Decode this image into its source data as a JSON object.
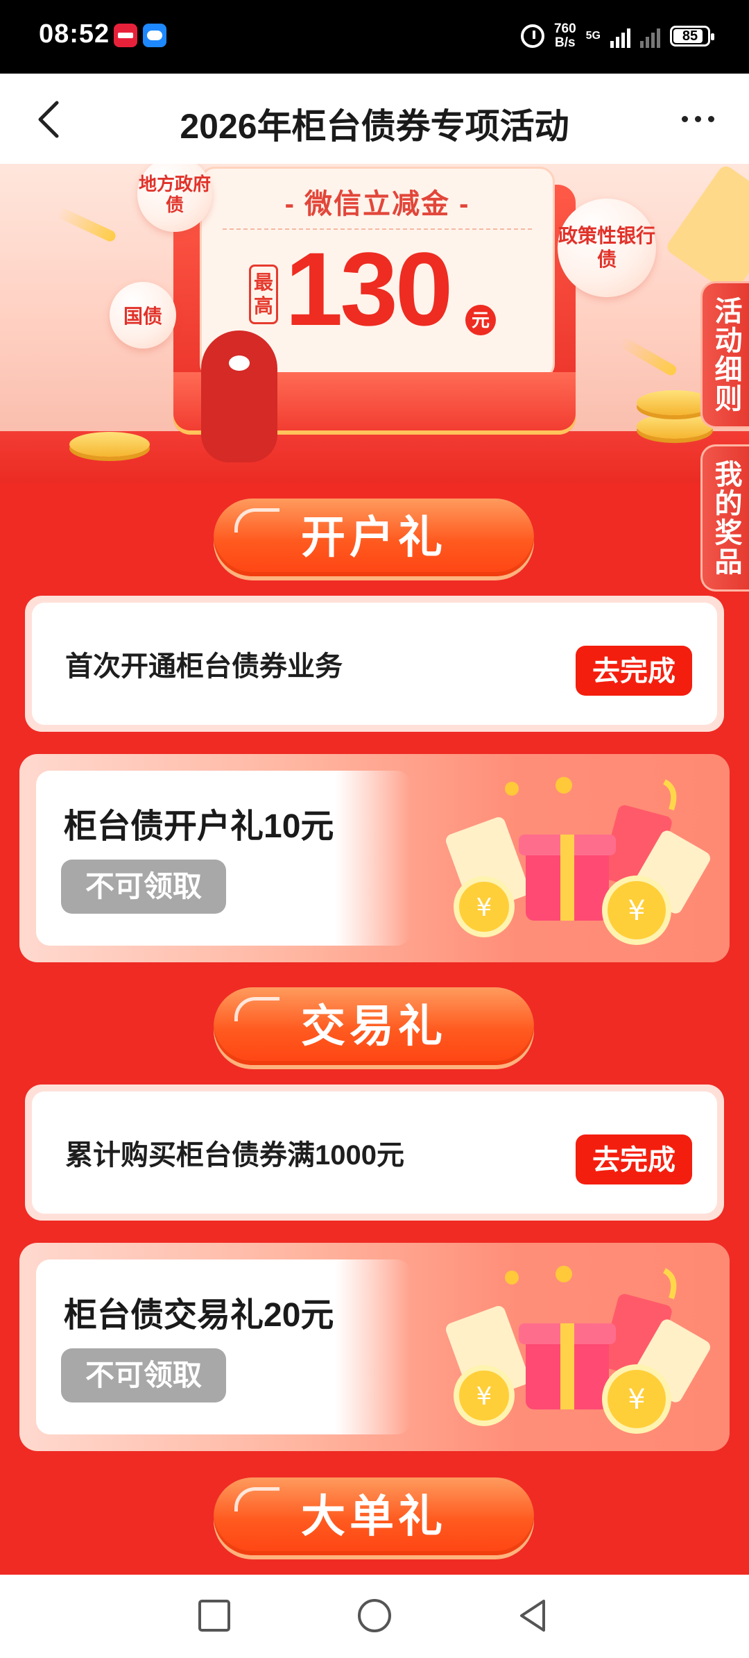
{
  "status_bar": {
    "time": "08:52",
    "net_speed_value": "760",
    "net_speed_unit": "B/s",
    "network_type": "5G",
    "battery": "85",
    "icons": [
      "alarm-icon",
      "signal-icon",
      "battery-icon"
    ]
  },
  "nav": {
    "title": "2026年柜台债券专项活动"
  },
  "hero": {
    "card_title": "- 微信立减金 -",
    "max_label": "最高",
    "amount": "130",
    "unit": "元",
    "bubble_local": "地方政府债",
    "bubble_national": "国债",
    "bubble_policy": "政策性银行债"
  },
  "side_tabs": {
    "rules": "活动细则",
    "prizes": "我的奖品"
  },
  "sections": [
    {
      "title": "开户礼",
      "task_text": "首次开通柜台债券业务",
      "task_button": "去完成",
      "reward_title": "柜台债开户礼10元",
      "reward_button": "不可领取"
    },
    {
      "title": "交易礼",
      "task_text": "累计购买柜台债券满1000元",
      "task_button": "去完成",
      "reward_title": "柜台债交易礼20元",
      "reward_button": "不可领取"
    },
    {
      "title": "大单礼"
    }
  ],
  "colors": {
    "page_bg": "#ef2b24",
    "accent": "#f41e0e",
    "disabled": "#a8a8a8"
  }
}
